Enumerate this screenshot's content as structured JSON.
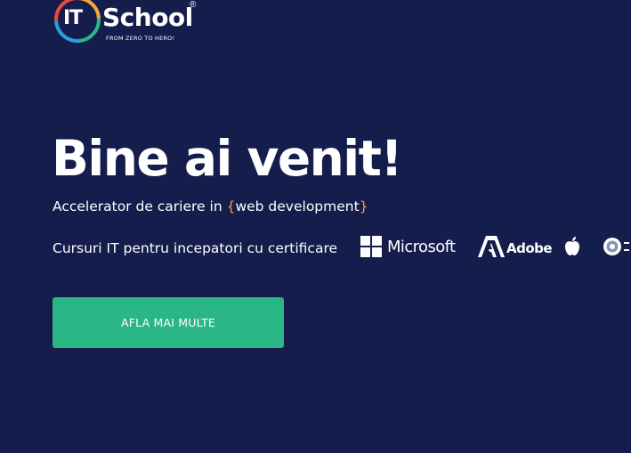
{
  "logo": {
    "it": "IT",
    "school": "School",
    "registered": "®",
    "tagline": "FROM ZERO TO HERO!"
  },
  "hero": {
    "title": "Bine ai venit!",
    "subtitle_prefix": "Accelerator de cariere in ",
    "brace_open": "{",
    "subtitle_highlight": "web development",
    "brace_close": "}",
    "courses_text": "Cursuri IT pentru incepatori cu certificare"
  },
  "partners": {
    "microsoft_label": "Microsoft",
    "adobe_label": "Adobe",
    "apple_icon": "apple-icon",
    "ministry_icon": "ministry-seal-icon"
  },
  "cta": {
    "label": "AFLA MAI MULTE"
  },
  "colors": {
    "background": "#141d4c",
    "accent_green": "#2bb685",
    "brace_orange": "#f2a63b",
    "text": "#ffffff"
  }
}
